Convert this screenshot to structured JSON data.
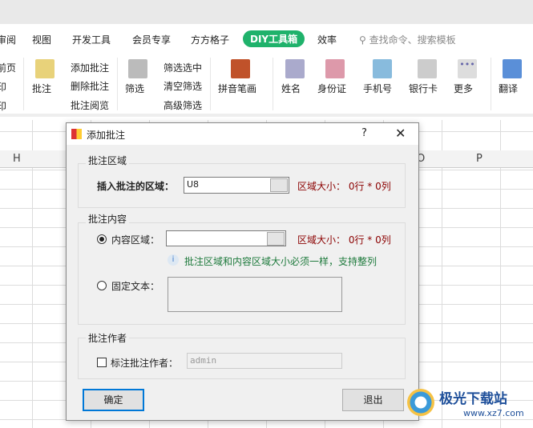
{
  "tabs": [
    "审阅",
    "视图",
    "开发工具",
    "会员专享",
    "方方格子",
    "DIY工具箱",
    "效率"
  ],
  "search_placeholder": "查找命令、搜索模板",
  "ribbon": {
    "left_cut": [
      "前页",
      "印",
      "印"
    ],
    "comment": "批注",
    "add_comment": "添加批注",
    "delete_comment": "删除批注",
    "browse_comment": "批注阅览",
    "filter": "筛选",
    "filter_selected": "筛选选中",
    "clear_filter": "清空筛选",
    "advanced_filter": "高级筛选",
    "pinyin": "拼音笔画",
    "name": "姓名",
    "idcard": "身份证",
    "phone": "手机号",
    "bankcard": "银行卡",
    "more": "更多",
    "translate": "翻译"
  },
  "columns": [
    "H",
    "O",
    "P"
  ],
  "dialog": {
    "title": "添加批注",
    "help": "?",
    "group1": {
      "label": "批注区域",
      "field_label": "插入批注的区域：",
      "value": "U8",
      "size": "区域大小： 0行 * 0列"
    },
    "group2": {
      "label": "批注内容",
      "radio1": "内容区域：",
      "value": "",
      "size": "区域大小： 0行 * 0列",
      "info": "批注区域和内容区域大小必须一样，支持整列",
      "radio2": "固定文本："
    },
    "group3": {
      "label": "批注作者",
      "checkbox": "标注批注作者：",
      "placeholder": "admin"
    },
    "ok": "确定",
    "exit": "退出"
  },
  "watermark": {
    "name": "极光下载站",
    "url": "www.xz7.com"
  },
  "colors": {
    "accent": "#1fb26b",
    "size_text": "#8b0000",
    "info_text": "#1e7a3c"
  }
}
